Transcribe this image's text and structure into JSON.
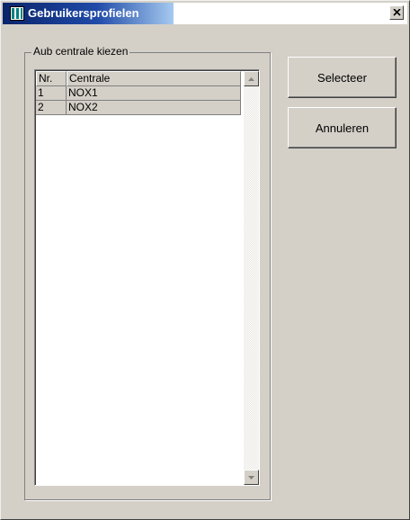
{
  "window": {
    "title": "Gebruikersprofielen",
    "close_label": "×"
  },
  "group": {
    "legend": "Aub centrale kiezen"
  },
  "list": {
    "columns": [
      "Nr.",
      "Centrale"
    ],
    "rows": [
      [
        "1",
        "NOX1"
      ],
      [
        "2",
        "NOX2"
      ]
    ]
  },
  "buttons": {
    "select": "Selecteer",
    "cancel": "Annuleren"
  },
  "icons": {
    "app": "app-icon",
    "close": "close-icon",
    "scroll_up": "arrow-up-icon",
    "scroll_down": "arrow-down-icon"
  },
  "colors": {
    "titlebar_start": "#0a246a",
    "titlebar_end": "#a6caf0",
    "face": "#d4d0c8"
  }
}
